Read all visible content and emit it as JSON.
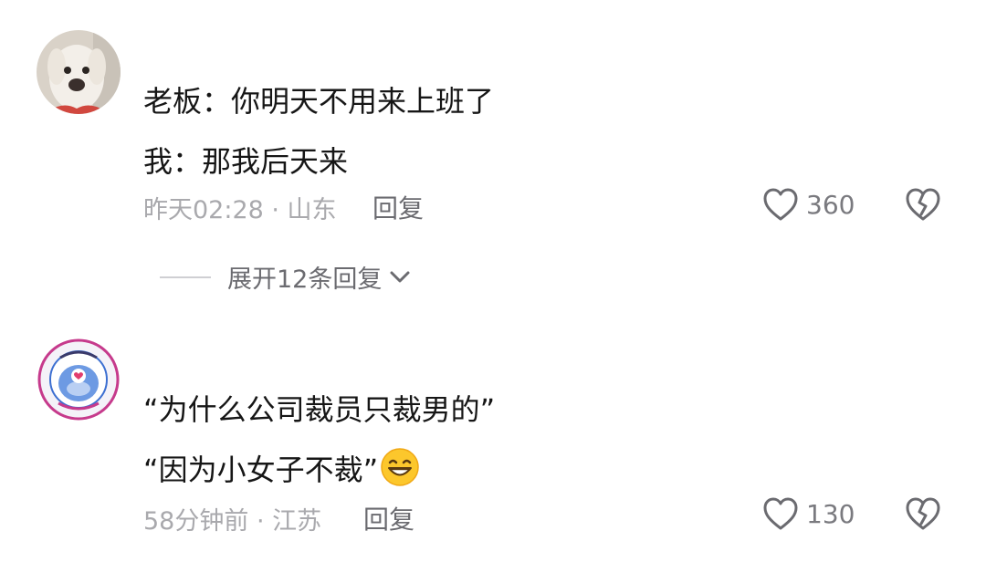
{
  "comments": [
    {
      "line1": "老板：你明天不用来上班了",
      "line2": "我：那我后天来",
      "meta": "昨天02:28 · 山东",
      "reply_label": "回复",
      "likes": "360",
      "avatar_icon": "dog-avatar-icon"
    },
    {
      "line1": "“为什么公司裁员只裁男的”",
      "line2": "“因为小女子不裁”",
      "meta": "58分钟前 · 江苏",
      "reply_label": "回复",
      "likes": "130",
      "avatar_icon": "cartoon-badge-avatar-icon",
      "emoji": "grinning-face-icon"
    }
  ],
  "expand_replies": {
    "label": "展开12条回复"
  },
  "colors": {
    "text": "#161616",
    "meta": "#a9a9ad",
    "secondary": "#6b6b70",
    "icon": "#6b6b70"
  }
}
